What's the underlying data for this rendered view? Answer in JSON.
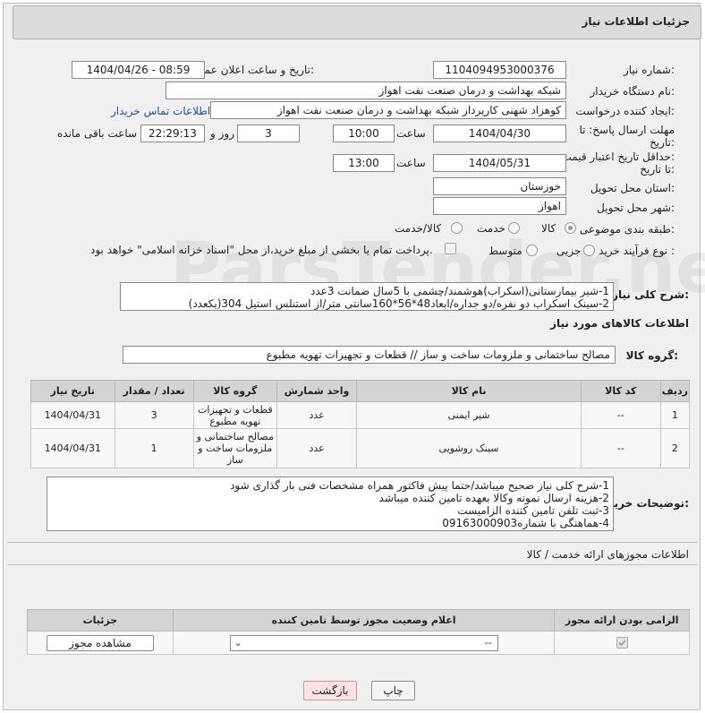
{
  "header": {
    "title": "جزئیات اطلاعات نیاز"
  },
  "form": {
    "need_number_label": "شماره نیاز:",
    "need_number": "1104094953000376",
    "announce_label": "تاریخ و ساعت اعلان عمومی:",
    "announce_value": "1404/04/26 - 08:59",
    "buyer_org_label": "نام دستگاه خریدار:",
    "buyer_org": "شبکه بهداشت و درمان صنعت نفت اهواز",
    "creator_label": "ایجاد کننده درخواست:",
    "creator": "کوهزاد شهنی کارپرداز شبکه بهداشت و درمان صنعت نفت اهواز",
    "contact_link": "اطلاعات تماس خریدار",
    "deadline_label_1": "مهلت ارسال پاسخ: تا",
    "deadline_label_2": "تاریخ:",
    "deadline_date": "1404/04/30",
    "time_label": "ساعت",
    "deadline_time": "10:00",
    "days_value": "3",
    "days_label": "روز و",
    "remaining_time": "22:29:13",
    "remaining_label": "ساعت باقی مانده",
    "validity_label_1": "حداقل تاریخ اعتبار قیمت:",
    "validity_label_2": "تا تاریخ:",
    "validity_date": "1404/05/31",
    "validity_time": "13:00",
    "province_label": "استان محل تحویل:",
    "province": "خوزستان",
    "city_label": "شهر محل تحویل:",
    "city": "اهواز",
    "category_label": "طبقه بندی موضوعی:",
    "category_options": [
      "کالا",
      "خدمت",
      "کالا/خدمت"
    ],
    "process_label": "نوع فرآیند خرید :",
    "process_options": [
      "جزیی",
      "متوسط"
    ],
    "payment_note": "پرداخت تمام یا بخشی از مبلغ خرید،از محل \"اسناد خزانه اسلامی\" خواهد بود."
  },
  "general_desc": {
    "label": "شرح کلی نیاز:",
    "line1": "1-شیر بیمارستانی(اسکراب)هوشمند/چشمی با 5سال ضمانت 3عدد",
    "line2": "2-سینک اسکراب دو نفره/دو جداره/ابعاد48*56*160سانتی متر/از استنلس استیل 304(یکعدد)"
  },
  "goods": {
    "section_title": "اطلاعات کالاهای مورد نیاز",
    "group_label": "گروه کالا:",
    "group_value": "مصالح ساختمانی و ملزومات ساخت و ساز //  قطعات و تجهیزات تهویه مطبوع",
    "columns": [
      "ردیف",
      "کد کالا",
      "نام کالا",
      "واحد شمارش",
      "گروه کالا",
      "تعداد / مقدار",
      "تاریخ نیاز"
    ],
    "rows": [
      {
        "idx": "1",
        "code": "--",
        "name": "شیر ایمنی",
        "unit": "عدد",
        "group": "قطعات و تجهیزات تهویه مطبوع",
        "qty": "3",
        "date": "1404/04/31"
      },
      {
        "idx": "2",
        "code": "--",
        "name": "سینک روشویی",
        "unit": "عدد",
        "group": "مصالح ساختمانی و ملزومات ساخت و ساز",
        "qty": "1",
        "date": "1404/04/31"
      }
    ]
  },
  "buyer_notes": {
    "label": "توضیحات خریدار:",
    "line1": "1-شرح کلی نیاز صحیح میباشد/حتما پیش فاکتور همراه مشخصات فنی بار گذاری شود",
    "line2": "2-هزینه ارسال نمونه وکالا بعهده تامین کننده میباشد",
    "line3": "3-ثبت تلفن تامین کننده الزامیست",
    "line4": "4-هماهنگی با شماره09163000903"
  },
  "permits": {
    "section_title": "اطلاعات مجوزهای ارائه خدمت / کالا",
    "columns": [
      "الزامی بودن ارائه مجوز",
      "اعلام وضعیت مجوز توسط تامین کننده",
      "جزئیات"
    ],
    "select_value": "--",
    "view_button": "مشاهده مجوز"
  },
  "footer": {
    "print_button": "چاپ",
    "back_button": "بازگشت"
  },
  "watermark": "ParsTender.net"
}
